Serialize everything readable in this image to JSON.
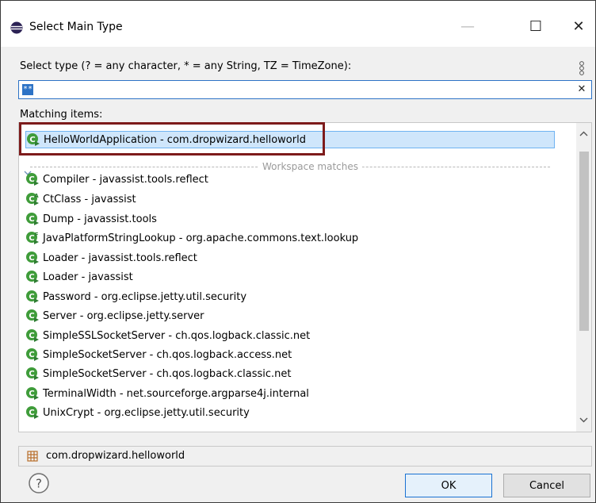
{
  "window": {
    "title": "Select Main Type",
    "controls": {
      "minimize": "—",
      "maximize": "☐",
      "close": "✕"
    }
  },
  "filter": {
    "label": "Select type (? = any character, * = any String, TZ = TimeZone):",
    "value": "**",
    "clear_glyph": "✕"
  },
  "list": {
    "label": "Matching items:",
    "selected_item": "HelloWorldApplication - com.dropwizard.helloworld",
    "separator_label": "Workspace matches",
    "items": [
      {
        "text": "Compiler - javassist.tools.reflect",
        "icon": "class-main-icon"
      },
      {
        "text": "CtClass - javassist",
        "icon": "abstract-class-main-icon"
      },
      {
        "text": "Dump - javassist.tools",
        "icon": "class-main-icon"
      },
      {
        "text": "JavaPlatformStringLookup - org.apache.commons.text.lookup",
        "icon": "final-class-main-icon"
      },
      {
        "text": "Loader - javassist.tools.reflect",
        "icon": "class-main-icon"
      },
      {
        "text": "Loader - javassist",
        "icon": "class-main-icon"
      },
      {
        "text": "Password - org.eclipse.jetty.util.security",
        "icon": "class-main-icon"
      },
      {
        "text": "Server - org.eclipse.jetty.server",
        "icon": "class-main-icon"
      },
      {
        "text": "SimpleSSLSocketServer - ch.qos.logback.classic.net",
        "icon": "class-main-icon"
      },
      {
        "text": "SimpleSocketServer - ch.qos.logback.access.net",
        "icon": "class-main-icon"
      },
      {
        "text": "SimpleSocketServer - ch.qos.logback.classic.net",
        "icon": "class-main-icon"
      },
      {
        "text": "TerminalWidth - net.sourceforge.argparse4j.internal",
        "icon": "class-main-icon"
      },
      {
        "text": "UnixCrypt - org.eclipse.jetty.util.security",
        "icon": "class-main-icon"
      }
    ]
  },
  "package": {
    "text": "com.dropwizard.helloworld"
  },
  "buttons": {
    "ok": "OK",
    "cancel": "Cancel"
  },
  "colors": {
    "selection": "#cfe6fb",
    "accent": "#2d73c6",
    "highlight_box": "#7d1b1b",
    "class_icon_green": "#3f9c3a"
  }
}
